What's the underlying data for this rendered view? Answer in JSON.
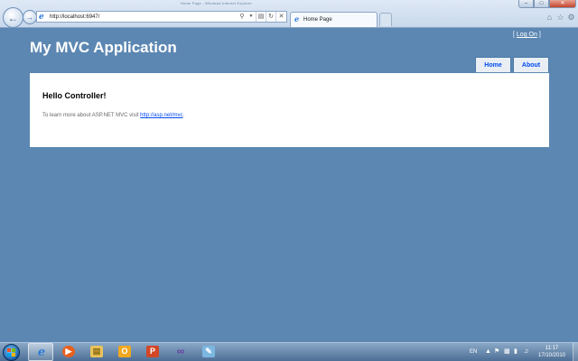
{
  "window": {
    "title": "Home Page - Windows Internet Explorer"
  },
  "address_bar": {
    "url": "http://localhost:6947/"
  },
  "tabs": [
    {
      "label": "Home Page",
      "active": true
    }
  ],
  "icons": {
    "back": "back-arrow-icon",
    "forward": "forward-arrow-icon",
    "search": "magnifier-icon",
    "compat": "compatibility-view-icon",
    "refresh": "refresh-icon",
    "stop": "stop-x-icon",
    "home": "home-icon",
    "favorites": "star-icon",
    "tools": "gear-icon"
  },
  "site": {
    "title": "My MVC Application",
    "logon": {
      "open_bracket": "[",
      "link": "Log On",
      "close_bracket": "]"
    },
    "menu": [
      {
        "label": "Home"
      },
      {
        "label": "About"
      }
    ],
    "main": {
      "heading": "Hello Controller!",
      "text_prefix": "To learn more about ASP.NET MVC visit ",
      "link": "http://asp.net/mvc",
      "text_suffix": "."
    }
  },
  "taskbar": {
    "apps": [
      {
        "name": "Internet Explorer",
        "icon": "internet-explorer-icon",
        "active": true
      },
      {
        "name": "Windows Media Player",
        "icon": "media-player-icon",
        "active": false
      },
      {
        "name": "Windows Explorer",
        "icon": "folder-icon",
        "active": false
      },
      {
        "name": "Outlook",
        "icon": "outlook-icon",
        "active": false
      },
      {
        "name": "PowerPoint",
        "icon": "powerpoint-icon",
        "active": false
      },
      {
        "name": "Visual Studio",
        "icon": "visual-studio-icon",
        "active": false
      },
      {
        "name": "Paint",
        "icon": "paint-icon",
        "active": false
      }
    ],
    "tray": {
      "language": "EN",
      "time": "11:17",
      "date": "17/10/2010"
    }
  },
  "colors": {
    "page_background": "#5c87b2",
    "content_background": "#ffffff",
    "link": "#034af3",
    "menu_tab": "#e8eef4"
  }
}
